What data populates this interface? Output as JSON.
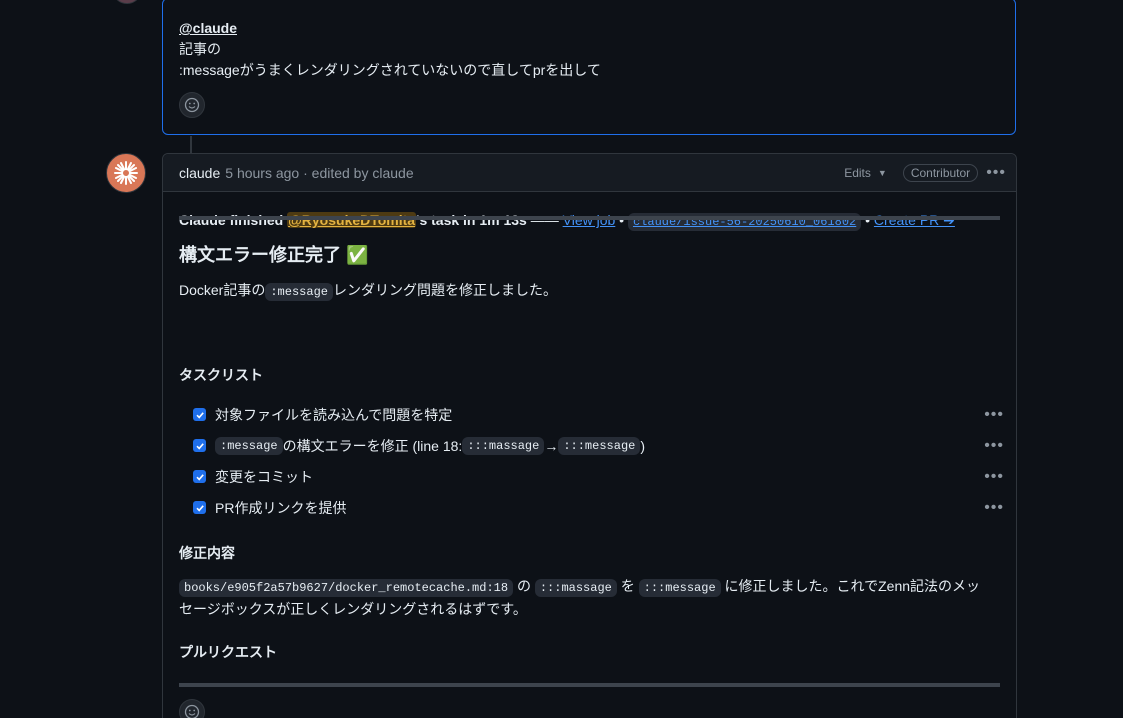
{
  "top_comment": {
    "mention": "@claude",
    "line1": "記事の",
    "line2": ":messageがうまくレンダリングされていないので直してprを出して"
  },
  "main_comment": {
    "author": "claude",
    "meta": "5 hours ago · edited by claude",
    "edits_label": "Edits",
    "role_badge": "Contributor",
    "status": {
      "prefix": "Claude finished ",
      "user": "@RyosukeDTomita",
      "suffix": "'s task in 1m 13s",
      "dash": " —— ",
      "view_job": "View job",
      "sep1": " • ",
      "branch": "claude/issue-56-20250610_061802",
      "sep2": " • ",
      "create_pr": "Create PR ➔"
    },
    "heading": "構文エラー修正完了 ✅",
    "intro": {
      "prefix": "Docker記事の",
      "code": ":message",
      "suffix": "レンダリング問題を修正しました。"
    },
    "tasks_heading": "タスクリスト",
    "tasks": [
      {
        "text": "対象ファイルを読み込んで問題を特定"
      },
      {
        "code1": ":message",
        "text": " の構文エラーを修正 (line 18: ",
        "code2": ":::massage",
        "arrow": " → ",
        "code3": ":::message",
        "end": ")"
      },
      {
        "text": "変更をコミット"
      },
      {
        "text": "PR作成リンクを提供"
      }
    ],
    "fix_heading": "修正内容",
    "fix": {
      "code_path": "books/e905f2a57b9627/docker_remotecache.md:18",
      "t1": " の ",
      "code_old": ":::massage",
      "t2": " を ",
      "code_new": ":::message",
      "t3": " に修正しました。これでZenn記法のメッセージボックスが正しくレンダリングされるはずです。"
    },
    "pr_heading": "プルリクエスト"
  },
  "colors": {
    "background": "#0d1117",
    "accent_border": "#1f6feb",
    "link": "#4493f8",
    "mention_bg": "#4d3a12",
    "claude_avatar": "#d97757"
  }
}
